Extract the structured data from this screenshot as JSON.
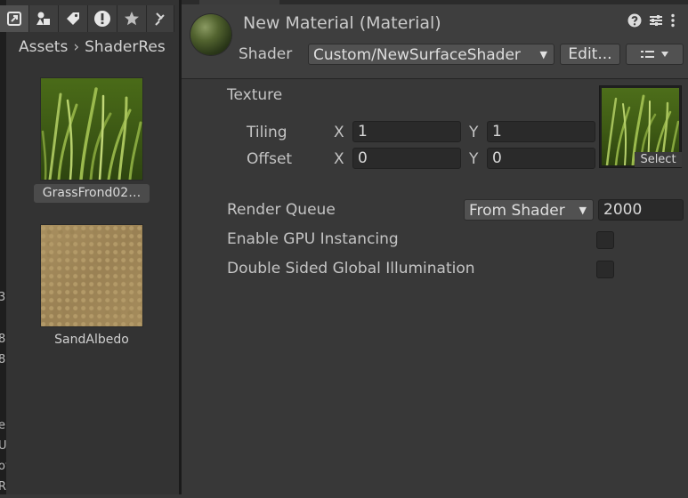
{
  "project": {
    "breadcrumb": [
      "Assets",
      "ShaderRes"
    ],
    "assets": [
      {
        "name": "GrassFrond02…",
        "kind": "texture-grass"
      },
      {
        "name": "SandAlbedo",
        "kind": "texture-sand"
      }
    ],
    "tool_icons": [
      "scene-link-icon",
      "shapes-icon",
      "tag-icon",
      "warning-icon",
      "star-icon",
      "pin-icon"
    ],
    "clipped_letters": [
      "3",
      "8",
      "8",
      "e",
      "U",
      "ot",
      "R"
    ]
  },
  "inspector": {
    "title": "New Material (Material)",
    "shader_label": "Shader",
    "shader_value": "Custom/NewSurfaceShader",
    "edit_button": "Edit...",
    "texture_label": "Texture",
    "tiling_label": "Tiling",
    "offset_label": "Offset",
    "x_label": "X",
    "y_label": "Y",
    "tiling_x": "1",
    "tiling_y": "1",
    "offset_x": "0",
    "offset_y": "0",
    "select_label": "Select",
    "render_queue_label": "Render Queue",
    "render_queue_mode": "From Shader",
    "render_queue_value": "2000",
    "gpu_instancing_label": "Enable GPU Instancing",
    "double_sided_label": "Double Sided Global Illumination",
    "gpu_instancing_checked": false,
    "double_sided_checked": false
  }
}
